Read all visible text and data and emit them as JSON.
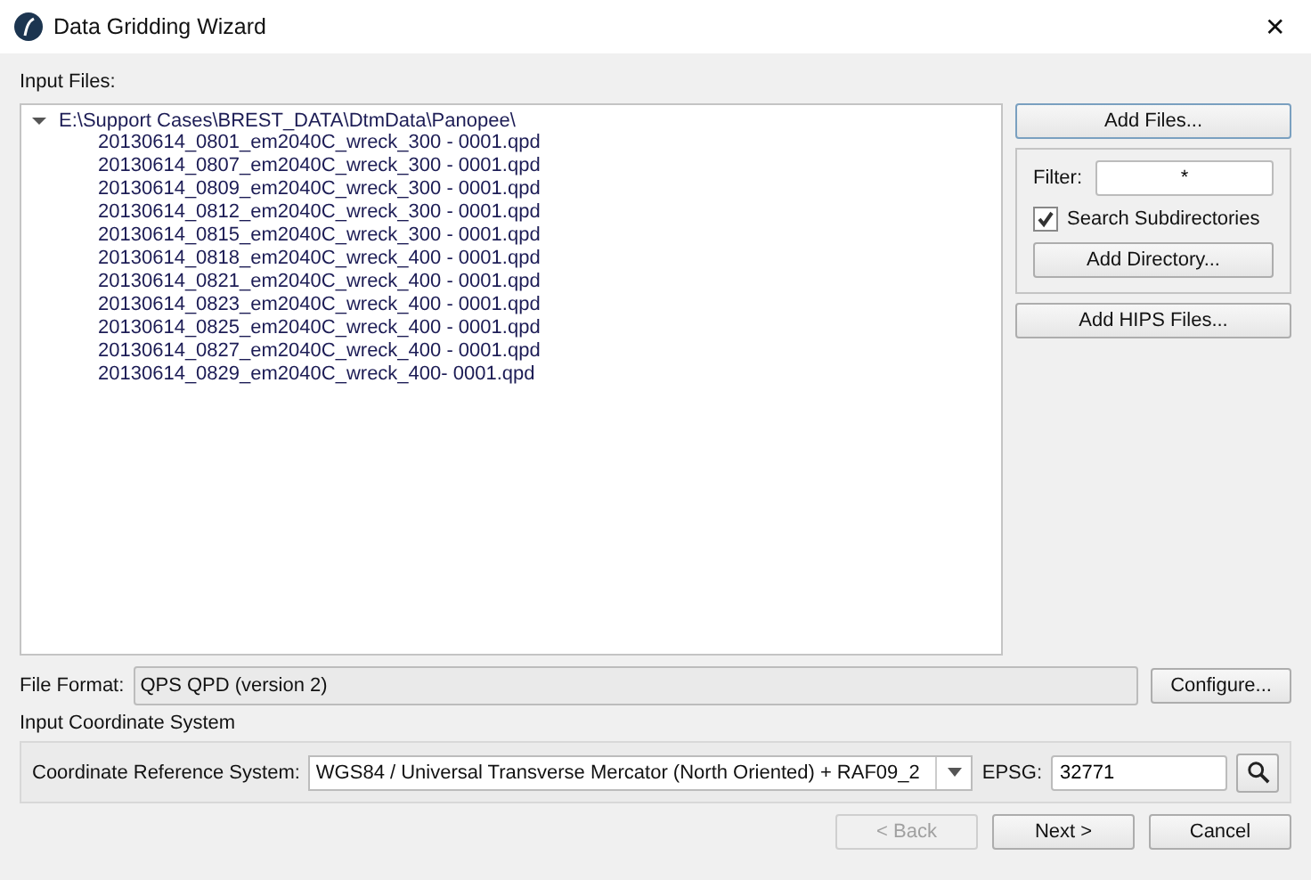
{
  "window": {
    "title": "Data Gridding Wizard",
    "close": "✕"
  },
  "input_files": {
    "label": "Input Files:",
    "tree": [
      {
        "label": "E:\\Support Cases\\BREST_DATA\\DtmData\\Panopee\\",
        "expanded": true,
        "children": [
          {
            "label": "20130614_0801_em2040C_wreck_300 - 0001.qpd"
          },
          {
            "label": "20130614_0807_em2040C_wreck_300 - 0001.qpd"
          },
          {
            "label": "20130614_0809_em2040C_wreck_300 - 0001.qpd"
          },
          {
            "label": "20130614_0812_em2040C_wreck_300 - 0001.qpd"
          },
          {
            "label": "20130614_0815_em2040C_wreck_300 - 0001.qpd"
          },
          {
            "label": "20130614_0818_em2040C_wreck_400 - 0001.qpd"
          },
          {
            "label": "20130614_0821_em2040C_wreck_400 - 0001.qpd"
          },
          {
            "label": "20130614_0823_em2040C_wreck_400 - 0001.qpd"
          },
          {
            "label": "20130614_0825_em2040C_wreck_400 - 0001.qpd"
          },
          {
            "label": "20130614_0827_em2040C_wreck_400 - 0001.qpd"
          },
          {
            "label": "20130614_0829_em2040C_wreck_400- 0001.qpd"
          }
        ]
      }
    ]
  },
  "add_files": "Add Files...",
  "filter": {
    "label": "Filter:",
    "value": "*"
  },
  "search_subdirectories": {
    "label": "Search Subdirectories",
    "checked": true
  },
  "add_directory": "Add Directory...",
  "add_hips_files": "Add HIPS Files...",
  "file_format": {
    "label": "File Format:",
    "value": "QPS QPD (version 2)",
    "button": "Configure..."
  },
  "coordinate_system": {
    "heading": "Input Coordinate System",
    "crs_label": "Coordinate Reference System:",
    "crs_value": "WGS84 / Universal Transverse Mercator (North Oriented) + RAF09_2",
    "epsg_label": "EPSG:",
    "epsg_value": "32771"
  },
  "buttons": [
    {
      "label": "< Back",
      "disabled": true
    },
    {
      "label": "Next >",
      "disabled": false
    },
    {
      "label": "Cancel",
      "disabled": false
    }
  ]
}
